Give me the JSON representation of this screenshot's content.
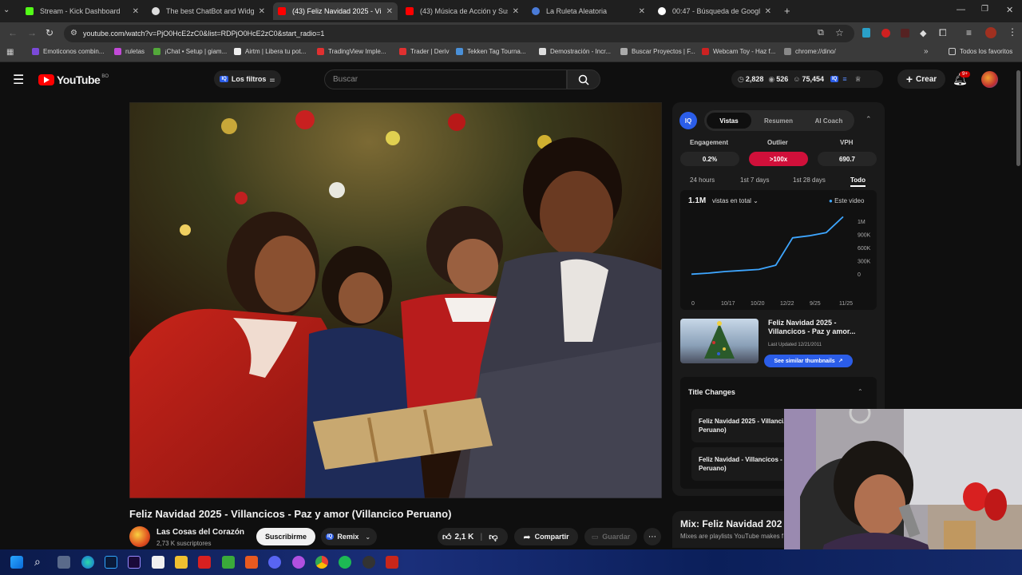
{
  "browser": {
    "tabs": [
      {
        "title": "Stream - Kick Dashboard",
        "color": "#53fc18",
        "active": false
      },
      {
        "title": "The best ChatBot and Widgets",
        "color": "#ffffff",
        "active": false
      },
      {
        "title": "(43) Feliz Navidad 2025 - Villan",
        "color": "#ff0000",
        "active": true
      },
      {
        "title": "(43) Música de Acción y Suspen",
        "color": "#ff0000",
        "active": false
      },
      {
        "title": "La Ruleta Aleatoria",
        "color": "#4a7bd8",
        "active": false
      },
      {
        "title": "00:47 - Búsqueda de Google",
        "color": "#ffffff",
        "active": false
      }
    ],
    "new_tab_label": "+",
    "url": "youtube.com/watch?v=PjO0HcE2zC0&list=RDPjO0HcE2zC0&start_radio=1",
    "bookmarks": [
      {
        "label": "Emoticonos combin...",
        "color": "#7b4ad8"
      },
      {
        "label": "ruletas",
        "color": "#c24ad8"
      },
      {
        "label": "¡Chat • Setup | giam...",
        "color": "#53a83a"
      },
      {
        "label": "Airtm | Libera tu pot...",
        "color": "#eeeeee"
      },
      {
        "label": "TradingView Imple...",
        "color": "#e03030"
      },
      {
        "label": "Trader | Deriv",
        "color": "#e03030"
      },
      {
        "label": "Tekken Tag Tourna...",
        "color": "#4a90d8"
      },
      {
        "label": "Demostración - Incr...",
        "color": "#dddddd"
      },
      {
        "label": "Buscar Proyectos | F...",
        "color": "#aaaaaa"
      },
      {
        "label": "Webcam Toy - Haz f...",
        "color": "#cc2222"
      },
      {
        "label": "chrome://dino/",
        "color": "#888888"
      }
    ],
    "all_bookmarks_label": "Todos los favoritos"
  },
  "youtube": {
    "logo_text": "YouTube",
    "country_code": "BO",
    "filters_label": "Los filtros",
    "search_placeholder": "Buscar",
    "stats": {
      "a": "2,828",
      "b": "526",
      "c": "75,454"
    },
    "create_label": "Crear",
    "notif_badge": "9+"
  },
  "video": {
    "title": "Feliz Navidad 2025 - Villancicos - Paz y amor (Villancico Peruano)",
    "channel_name": "Las Cosas del Corazón",
    "subscribers": "2,73 K suscriptores",
    "subscribe_label": "Suscribirme",
    "remix_label": "Remix",
    "likes": "2,1 K",
    "share_label": "Compartir",
    "save_label": "Guardar"
  },
  "iq_panel": {
    "logo": "IQ",
    "tabs": [
      "Vistas",
      "Resumen",
      "AI Coach"
    ],
    "metrics": [
      {
        "label": "Engagement",
        "value": "0.2%"
      },
      {
        "label": "Outlier",
        "value": ">100x"
      },
      {
        "label": "VPH",
        "value": "690.7"
      }
    ],
    "ranges": [
      "24 hours",
      "1st 7 days",
      "1st 28 days",
      "Todo"
    ],
    "total_views": "1.1M",
    "views_dropdown": "vistas en total",
    "legend": "Este video",
    "related_title": "Feliz Navidad 2025 - Villancicos - Paz y amor...",
    "last_updated": "Last Updated 12/21/2011",
    "similar_label": "See similar thumbnails",
    "title_changes_label": "Title Changes",
    "title_changes": [
      "Feliz Navidad 2025 - Villanci... amor (Villancico Peruano)",
      "Feliz Navidad - Villancicos - amor (Villancico Peruano)"
    ]
  },
  "mix": {
    "title": "Mix: Feliz Navidad 202",
    "subtitle": "Mixes are playlists YouTube makes f"
  },
  "chart_data": {
    "type": "line",
    "x_labels": [
      "0",
      "10/17",
      "10/20",
      "12/22",
      "9/25",
      "11/25"
    ],
    "y_labels": [
      "1M",
      "900K",
      "600K",
      "300K",
      "0"
    ],
    "ylim": [
      0,
      1000000
    ],
    "series": [
      {
        "name": "Este video",
        "color": "#3ea6ff",
        "values": [
          10000,
          30000,
          60000,
          80000,
          100000,
          180000,
          700000,
          740000,
          800000,
          1100000
        ]
      }
    ]
  }
}
